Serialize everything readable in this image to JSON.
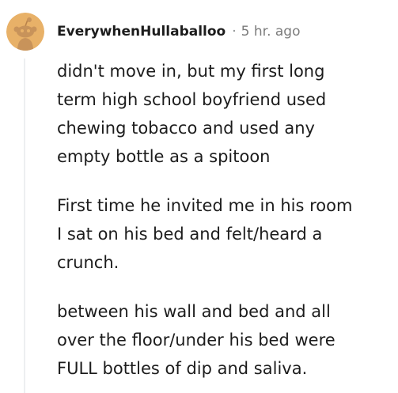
{
  "comment": {
    "username": "EverywhenHullaballoo",
    "separator": "·",
    "timestamp": "5 hr. ago",
    "avatar_icon": "snoo-avatar-icon",
    "paragraphs": [
      {
        "lines": [
          "didn't move in, but my first long",
          "term high school boyfriend used",
          "chewing tobacco and used any",
          "empty bottle as a spitoon"
        ]
      },
      {
        "lines": [
          "First time he invited me in his room",
          "I sat on his bed and felt/heard a",
          "crunch."
        ]
      },
      {
        "lines": [
          "between his wall and bed and all",
          "over the floor/under his bed were",
          "FULL bottles of dip and saliva."
        ]
      }
    ]
  },
  "colors": {
    "avatar_bg": "#e8b168",
    "snoo_body": "#c8935a",
    "text": "#1c1c1c",
    "meta": "#7c7c7c",
    "thread_line": "#edeff1"
  }
}
